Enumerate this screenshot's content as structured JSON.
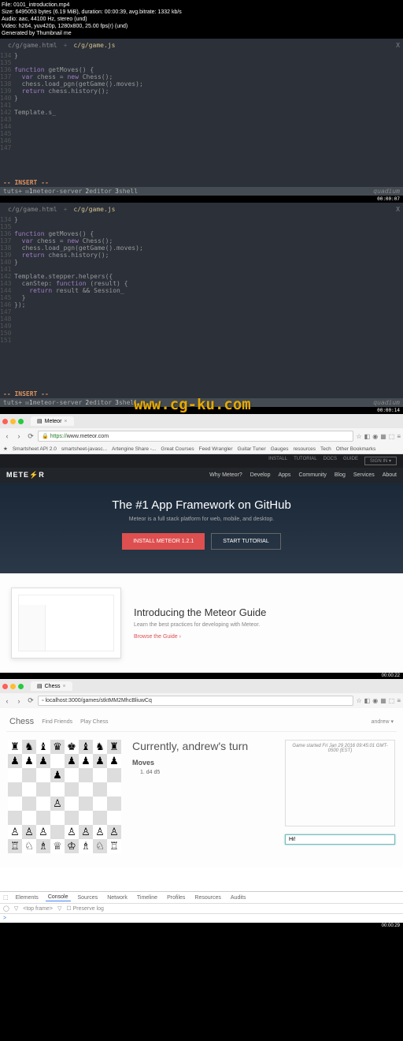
{
  "media_info": {
    "file": "File: 0101_introduction.mp4",
    "size": "Size: 6495053 bytes (6.19 MiB), duration: 00:00:39, avg.bitrate: 1332 kb/s",
    "audio": "Audio: aac, 44100 Hz, stereo (und)",
    "video": "Video: h264, yuv420p, 1280x800, 25.00 fps(r) (und)",
    "generated": "Generated by Thumbnail me"
  },
  "editor1": {
    "tab1": "c/g/game.html",
    "tab2": "c/g/game.js",
    "close": "X",
    "lines": {
      "134": "}",
      "135": "",
      "136": [
        "function",
        " getMoves",
        "() {"
      ],
      "137": [
        "  ",
        "var",
        " chess = ",
        "new",
        " Chess();"
      ],
      "138": "  chess.load_pgn(getGame().moves);",
      "139": [
        "  ",
        "return",
        " chess.history();"
      ],
      "140": "}",
      "141": "",
      "142": "Template.s_",
      "143": "",
      "144": "",
      "145": "",
      "146": "",
      "147": ""
    },
    "mode": "-- INSERT --",
    "status": {
      "tuts": "tuts+",
      "s1n": "1",
      "s1": "meteor-server",
      "s2n": "2",
      "s2": "editor",
      "s3n": "3",
      "s3": "shell",
      "right": "quadium"
    },
    "timestamp": "00:00:07"
  },
  "editor2": {
    "tab1": "c/g/game.html",
    "tab2": "c/g/game.js",
    "close": "X",
    "lines": {
      "134": "}",
      "135": "",
      "136": [
        "function",
        " getMoves",
        "() {"
      ],
      "137": [
        "  ",
        "var",
        " chess = ",
        "new",
        " Chess();"
      ],
      "138": "  chess.load_pgn(getGame().moves);",
      "139": [
        "  ",
        "return",
        " chess.history();"
      ],
      "140": "}",
      "141": "",
      "142": "Template.stepper.helpers({",
      "143": [
        "  canStep: ",
        "function",
        " (result) {"
      ],
      "144": [
        "    ",
        "return",
        " result && Session_"
      ],
      "145": "  }",
      "146": "});",
      "147": "",
      "148": "",
      "149": "",
      "150": "",
      "151": ""
    },
    "mode": "-- INSERT --",
    "status": {
      "tuts": "tuts+",
      "s1n": "1",
      "s1": "meteor-server",
      "s2n": "2",
      "s2": "editor",
      "s3n": "3",
      "s3": "shell",
      "right": "quadium"
    },
    "timestamp": "00:00:14"
  },
  "watermark": "www.cg-ku.com",
  "browser1": {
    "tab_title": "Meteor",
    "url_prefix": "https://",
    "url": "www.meteor.com",
    "bookmarks": [
      "★",
      "Smartsheet API 2.0",
      "smartsheet-javasc...",
      "Artengine Share -...",
      "Great Courses",
      "Feed Wrangler",
      "Guitar Tuner",
      "Gauges",
      "resources",
      "Tech",
      "Other Bookmarks"
    ],
    "subnav": [
      "INSTALL",
      "TUTORIAL",
      "DOCS",
      "GUIDE"
    ],
    "signin": "SIGN IN ▾",
    "logo": "METE⚡R",
    "nav": [
      "Why Meteor?",
      "Develop",
      "Apps",
      "Community",
      "Blog",
      "Services",
      "About"
    ],
    "hero_title": "The #1 App Framework on GitHub",
    "hero_sub": "Meteor is a full stack platform for web, mobile, and desktop.",
    "btn_install": "INSTALL METEOR 1.2.1",
    "btn_tutorial": "START TUTORIAL",
    "guide_title": "Introducing the Meteor Guide",
    "guide_sub": "Learn the best practices for developing with Meteor.",
    "guide_link": "Browse the Guide ›",
    "timestamp": "00:00:22"
  },
  "browser2": {
    "tab_title": "Chess",
    "url": "localhost:3000/games/stktMM2MhcBliuwCq",
    "nav_brand": "Chess",
    "nav_links": [
      "Find Friends",
      "Play Chess"
    ],
    "nav_user": "andrew ▾",
    "turn_title": "Currently, andrew's turn",
    "moves_title": "Moves",
    "moves": [
      "1. d4 d5"
    ],
    "side_msg": "Game started Fri Jan 29 2016 09:45:01 GMT-0500 (EST)",
    "chat_value": "Hi!",
    "board_top_pieces": [
      "♜",
      "♞",
      "♝",
      "♛",
      "♚",
      "♝",
      "♞",
      "♜"
    ],
    "board_pawns_black": "♟",
    "board_pawns_white": "♙",
    "board_bot_pieces": [
      "♖",
      "♘",
      "♗",
      "♕",
      "♔",
      "♗",
      "♘",
      "♖"
    ],
    "devtools": {
      "tabs": [
        "Elements",
        "Console",
        "Sources",
        "Network",
        "Timeline",
        "Profiles",
        "Resources",
        "Audits"
      ],
      "active": "Console",
      "controls": [
        "◯",
        "▽",
        "<top frame>",
        "▽",
        "☐ Preserve log"
      ],
      "prompt": ">"
    },
    "timestamp": "00:00:29"
  }
}
